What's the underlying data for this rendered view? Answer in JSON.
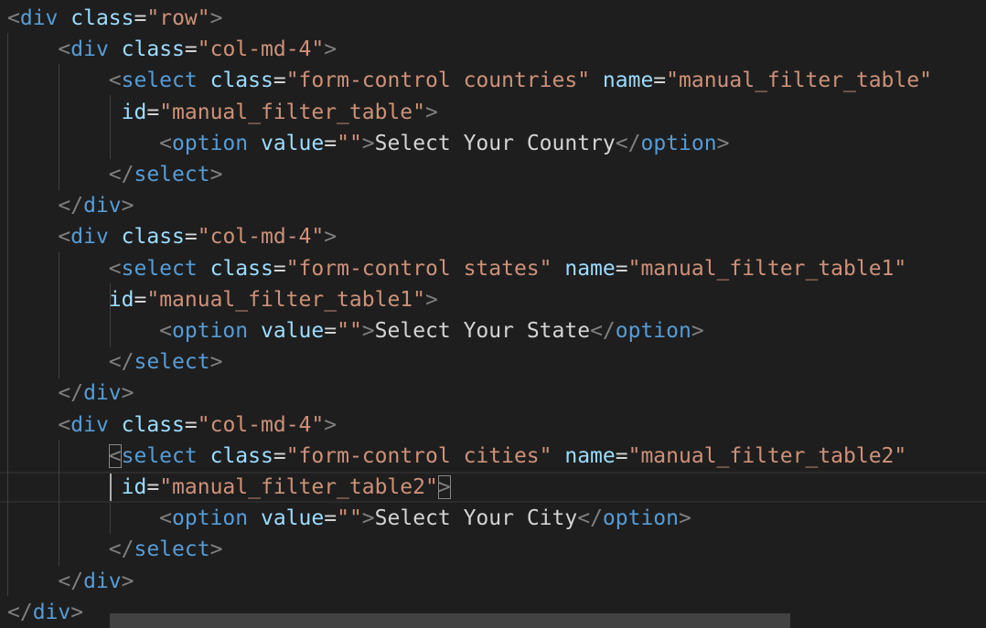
{
  "editor": {
    "language": "html",
    "lines": [
      {
        "indent": "",
        "tokens": [
          {
            "t": "punc",
            "v": "<"
          },
          {
            "t": "tag",
            "v": "div"
          },
          {
            "t": "txt",
            "v": " "
          },
          {
            "t": "attr",
            "v": "class"
          },
          {
            "t": "eq",
            "v": "="
          },
          {
            "t": "str",
            "v": "\"row\""
          },
          {
            "t": "punc",
            "v": ">"
          }
        ]
      },
      {
        "indent": "    ",
        "tokens": [
          {
            "t": "punc",
            "v": "<"
          },
          {
            "t": "tag",
            "v": "div"
          },
          {
            "t": "txt",
            "v": " "
          },
          {
            "t": "attr",
            "v": "class"
          },
          {
            "t": "eq",
            "v": "="
          },
          {
            "t": "str",
            "v": "\"col-md-4\""
          },
          {
            "t": "punc",
            "v": ">"
          }
        ]
      },
      {
        "indent": "        ",
        "tokens": [
          {
            "t": "punc",
            "v": "<"
          },
          {
            "t": "tag",
            "v": "select"
          },
          {
            "t": "txt",
            "v": " "
          },
          {
            "t": "attr",
            "v": "class"
          },
          {
            "t": "eq",
            "v": "="
          },
          {
            "t": "str",
            "v": "\"form-control countries\""
          },
          {
            "t": "txt",
            "v": " "
          },
          {
            "t": "attr",
            "v": "name"
          },
          {
            "t": "eq",
            "v": "="
          },
          {
            "t": "str",
            "v": "\"manual_filter_table\""
          }
        ]
      },
      {
        "indent": "         ",
        "tokens": [
          {
            "t": "attr",
            "v": "id"
          },
          {
            "t": "eq",
            "v": "="
          },
          {
            "t": "str",
            "v": "\"manual_filter_table\""
          },
          {
            "t": "punc",
            "v": ">"
          }
        ]
      },
      {
        "indent": "            ",
        "tokens": [
          {
            "t": "punc",
            "v": "<"
          },
          {
            "t": "tag",
            "v": "option"
          },
          {
            "t": "txt",
            "v": " "
          },
          {
            "t": "attr",
            "v": "value"
          },
          {
            "t": "eq",
            "v": "="
          },
          {
            "t": "str",
            "v": "\"\""
          },
          {
            "t": "punc",
            "v": ">"
          },
          {
            "t": "txt",
            "v": "Select Your Country"
          },
          {
            "t": "punc",
            "v": "</"
          },
          {
            "t": "tag",
            "v": "option"
          },
          {
            "t": "punc",
            "v": ">"
          }
        ]
      },
      {
        "indent": "        ",
        "tokens": [
          {
            "t": "punc",
            "v": "</"
          },
          {
            "t": "tag",
            "v": "select"
          },
          {
            "t": "punc",
            "v": ">"
          }
        ]
      },
      {
        "indent": "    ",
        "tokens": [
          {
            "t": "punc",
            "v": "</"
          },
          {
            "t": "tag",
            "v": "div"
          },
          {
            "t": "punc",
            "v": ">"
          }
        ]
      },
      {
        "indent": "    ",
        "tokens": [
          {
            "t": "punc",
            "v": "<"
          },
          {
            "t": "tag",
            "v": "div"
          },
          {
            "t": "txt",
            "v": " "
          },
          {
            "t": "attr",
            "v": "class"
          },
          {
            "t": "eq",
            "v": "="
          },
          {
            "t": "str",
            "v": "\"col-md-4\""
          },
          {
            "t": "punc",
            "v": ">"
          }
        ]
      },
      {
        "indent": "        ",
        "tokens": [
          {
            "t": "punc",
            "v": "<"
          },
          {
            "t": "tag",
            "v": "select"
          },
          {
            "t": "txt",
            "v": " "
          },
          {
            "t": "attr",
            "v": "class"
          },
          {
            "t": "eq",
            "v": "="
          },
          {
            "t": "str",
            "v": "\"form-control states\""
          },
          {
            "t": "txt",
            "v": " "
          },
          {
            "t": "attr",
            "v": "name"
          },
          {
            "t": "eq",
            "v": "="
          },
          {
            "t": "str",
            "v": "\"manual_filter_table1\""
          }
        ]
      },
      {
        "indent": "        ",
        "tokens": [
          {
            "t": "attr",
            "v": "id"
          },
          {
            "t": "eq",
            "v": "="
          },
          {
            "t": "str",
            "v": "\"manual_filter_table1\""
          },
          {
            "t": "punc",
            "v": ">"
          }
        ]
      },
      {
        "indent": "            ",
        "tokens": [
          {
            "t": "punc",
            "v": "<"
          },
          {
            "t": "tag",
            "v": "option"
          },
          {
            "t": "txt",
            "v": " "
          },
          {
            "t": "attr",
            "v": "value"
          },
          {
            "t": "eq",
            "v": "="
          },
          {
            "t": "str",
            "v": "\"\""
          },
          {
            "t": "punc",
            "v": ">"
          },
          {
            "t": "txt",
            "v": "Select Your State"
          },
          {
            "t": "punc",
            "v": "</"
          },
          {
            "t": "tag",
            "v": "option"
          },
          {
            "t": "punc",
            "v": ">"
          }
        ]
      },
      {
        "indent": "        ",
        "tokens": [
          {
            "t": "punc",
            "v": "</"
          },
          {
            "t": "tag",
            "v": "select"
          },
          {
            "t": "punc",
            "v": ">"
          }
        ]
      },
      {
        "indent": "    ",
        "tokens": [
          {
            "t": "punc",
            "v": "</"
          },
          {
            "t": "tag",
            "v": "div"
          },
          {
            "t": "punc",
            "v": ">"
          }
        ]
      },
      {
        "indent": "    ",
        "tokens": [
          {
            "t": "punc",
            "v": "<"
          },
          {
            "t": "tag",
            "v": "div"
          },
          {
            "t": "txt",
            "v": " "
          },
          {
            "t": "attr",
            "v": "class"
          },
          {
            "t": "eq",
            "v": "="
          },
          {
            "t": "str",
            "v": "\"col-md-4\""
          },
          {
            "t": "punc",
            "v": ">"
          }
        ]
      },
      {
        "indent": "        ",
        "tokens": [
          {
            "t": "punc",
            "v": "<",
            "hl": true
          },
          {
            "t": "tag",
            "v": "select"
          },
          {
            "t": "txt",
            "v": " "
          },
          {
            "t": "attr",
            "v": "class"
          },
          {
            "t": "eq",
            "v": "="
          },
          {
            "t": "str",
            "v": "\"form-control cities\""
          },
          {
            "t": "txt",
            "v": " "
          },
          {
            "t": "attr",
            "v": "name"
          },
          {
            "t": "eq",
            "v": "="
          },
          {
            "t": "str",
            "v": "\"manual_filter_table2\""
          }
        ]
      },
      {
        "indent": "         ",
        "tokens": [
          {
            "t": "attr",
            "v": "id"
          },
          {
            "t": "eq",
            "v": "="
          },
          {
            "t": "str",
            "v": "\"manual_filter_table2\""
          },
          {
            "t": "punc",
            "v": ">",
            "hl": true
          }
        ]
      },
      {
        "indent": "            ",
        "tokens": [
          {
            "t": "punc",
            "v": "<"
          },
          {
            "t": "tag",
            "v": "option"
          },
          {
            "t": "txt",
            "v": " "
          },
          {
            "t": "attr",
            "v": "value"
          },
          {
            "t": "eq",
            "v": "="
          },
          {
            "t": "str",
            "v": "\"\""
          },
          {
            "t": "punc",
            "v": ">"
          },
          {
            "t": "txt",
            "v": "Select Your City"
          },
          {
            "t": "punc",
            "v": "</"
          },
          {
            "t": "tag",
            "v": "option"
          },
          {
            "t": "punc",
            "v": ">"
          }
        ]
      },
      {
        "indent": "        ",
        "tokens": [
          {
            "t": "punc",
            "v": "</"
          },
          {
            "t": "tag",
            "v": "select"
          },
          {
            "t": "punc",
            "v": ">"
          }
        ]
      },
      {
        "indent": "    ",
        "tokens": [
          {
            "t": "punc",
            "v": "</"
          },
          {
            "t": "tag",
            "v": "div"
          },
          {
            "t": "punc",
            "v": ">"
          }
        ]
      },
      {
        "indent": "",
        "tokens": [
          {
            "t": "punc",
            "v": "</"
          },
          {
            "t": "tag",
            "v": "div"
          },
          {
            "t": "punc",
            "v": ">"
          }
        ]
      }
    ]
  }
}
